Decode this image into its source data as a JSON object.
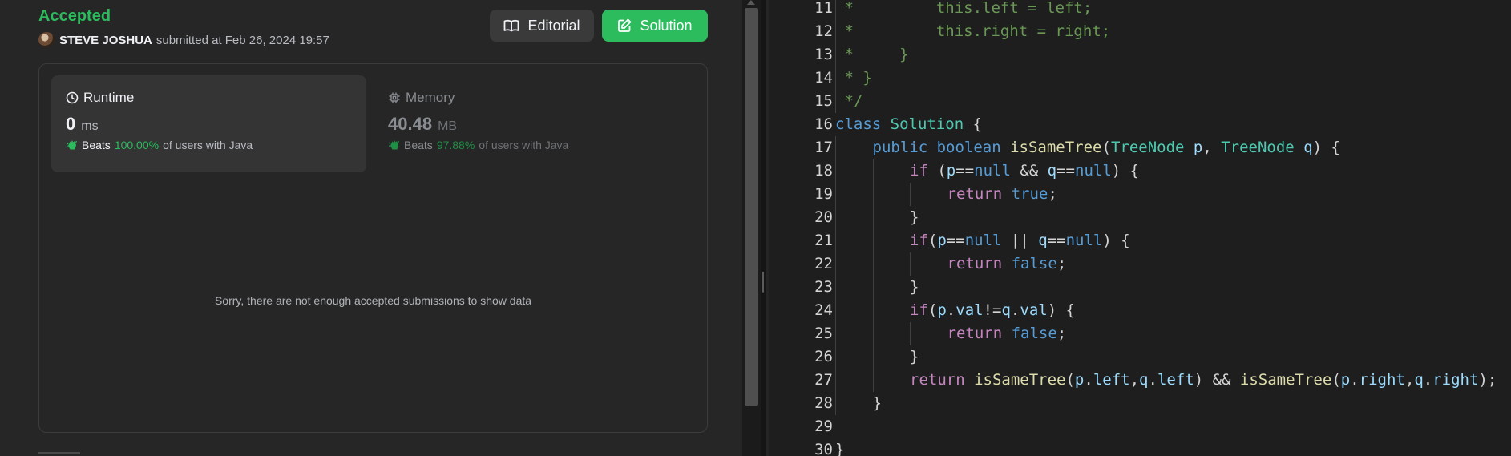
{
  "submission": {
    "status": "Accepted",
    "username": "STEVE JOSHUA",
    "submitted_text": "submitted at Feb 26, 2024 19:57"
  },
  "buttons": {
    "editorial": "Editorial",
    "solution": "Solution"
  },
  "runtime": {
    "label": "Runtime",
    "value": "0",
    "unit": "ms",
    "beats_label": "Beats",
    "beats_pct": "100.00%",
    "beats_tail": "of users with Java"
  },
  "memory": {
    "label": "Memory",
    "value": "40.48",
    "unit": "MB",
    "beats_label": "Beats",
    "beats_pct": "97.88%",
    "beats_tail": "of users with Java"
  },
  "chart_message": "Sorry, there are not enough accepted submissions to show data",
  "colors": {
    "accent_green": "#2cbb5d",
    "panel_bg": "#262626",
    "editor_bg": "#1e1e1e"
  },
  "code": {
    "language": "Java",
    "lines": [
      {
        "n": "11",
        "indent": 0,
        "tokens": [
          {
            "c": "comment",
            "t": " *         this.left = left;"
          }
        ]
      },
      {
        "n": "12",
        "indent": 0,
        "tokens": [
          {
            "c": "comment",
            "t": " *         this.right = right;"
          }
        ]
      },
      {
        "n": "13",
        "indent": 0,
        "tokens": [
          {
            "c": "comment",
            "t": " *     }"
          }
        ]
      },
      {
        "n": "14",
        "indent": 0,
        "tokens": [
          {
            "c": "comment",
            "t": " * }"
          }
        ]
      },
      {
        "n": "15",
        "indent": 0,
        "tokens": [
          {
            "c": "comment",
            "t": " */"
          }
        ]
      },
      {
        "n": "16",
        "indent": 0,
        "tokens": [
          {
            "c": "kw",
            "t": "class "
          },
          {
            "c": "type",
            "t": "Solution"
          },
          {
            "c": "plain",
            "t": " {"
          }
        ]
      },
      {
        "n": "17",
        "indent": 1,
        "tokens": [
          {
            "c": "kw",
            "t": "public "
          },
          {
            "c": "kw",
            "t": "boolean "
          },
          {
            "c": "fn",
            "t": "isSameTree"
          },
          {
            "c": "plain",
            "t": "("
          },
          {
            "c": "type",
            "t": "TreeNode"
          },
          {
            "c": "var",
            "t": " p"
          },
          {
            "c": "plain",
            "t": ", "
          },
          {
            "c": "type",
            "t": "TreeNode"
          },
          {
            "c": "var",
            "t": " q"
          },
          {
            "c": "plain",
            "t": ") {"
          }
        ]
      },
      {
        "n": "18",
        "indent": 2,
        "tokens": [
          {
            "c": "ctrl",
            "t": "if"
          },
          {
            "c": "plain",
            "t": " ("
          },
          {
            "c": "var",
            "t": "p"
          },
          {
            "c": "plain",
            "t": "=="
          },
          {
            "c": "kw",
            "t": "null"
          },
          {
            "c": "plain",
            "t": " && "
          },
          {
            "c": "var",
            "t": "q"
          },
          {
            "c": "plain",
            "t": "=="
          },
          {
            "c": "kw",
            "t": "null"
          },
          {
            "c": "plain",
            "t": ") {"
          }
        ]
      },
      {
        "n": "19",
        "indent": 3,
        "tokens": [
          {
            "c": "ctrl",
            "t": "return "
          },
          {
            "c": "kw",
            "t": "true"
          },
          {
            "c": "plain",
            "t": ";"
          }
        ]
      },
      {
        "n": "20",
        "indent": 2,
        "tokens": [
          {
            "c": "plain",
            "t": "}"
          }
        ]
      },
      {
        "n": "21",
        "indent": 2,
        "tokens": [
          {
            "c": "ctrl",
            "t": "if"
          },
          {
            "c": "plain",
            "t": "("
          },
          {
            "c": "var",
            "t": "p"
          },
          {
            "c": "plain",
            "t": "=="
          },
          {
            "c": "kw",
            "t": "null"
          },
          {
            "c": "plain",
            "t": " || "
          },
          {
            "c": "var",
            "t": "q"
          },
          {
            "c": "plain",
            "t": "=="
          },
          {
            "c": "kw",
            "t": "null"
          },
          {
            "c": "plain",
            "t": ") {"
          }
        ]
      },
      {
        "n": "22",
        "indent": 3,
        "tokens": [
          {
            "c": "ctrl",
            "t": "return "
          },
          {
            "c": "kw",
            "t": "false"
          },
          {
            "c": "plain",
            "t": ";"
          }
        ]
      },
      {
        "n": "23",
        "indent": 2,
        "tokens": [
          {
            "c": "plain",
            "t": "}"
          }
        ]
      },
      {
        "n": "24",
        "indent": 2,
        "tokens": [
          {
            "c": "ctrl",
            "t": "if"
          },
          {
            "c": "plain",
            "t": "("
          },
          {
            "c": "var",
            "t": "p"
          },
          {
            "c": "plain",
            "t": "."
          },
          {
            "c": "var",
            "t": "val"
          },
          {
            "c": "plain",
            "t": "!="
          },
          {
            "c": "var",
            "t": "q"
          },
          {
            "c": "plain",
            "t": "."
          },
          {
            "c": "var",
            "t": "val"
          },
          {
            "c": "plain",
            "t": ") {"
          }
        ]
      },
      {
        "n": "25",
        "indent": 3,
        "tokens": [
          {
            "c": "ctrl",
            "t": "return "
          },
          {
            "c": "kw",
            "t": "false"
          },
          {
            "c": "plain",
            "t": ";"
          }
        ]
      },
      {
        "n": "26",
        "indent": 2,
        "tokens": [
          {
            "c": "plain",
            "t": "}"
          }
        ]
      },
      {
        "n": "27",
        "indent": 2,
        "tokens": [
          {
            "c": "ctrl",
            "t": "return "
          },
          {
            "c": "fn",
            "t": "isSameTree"
          },
          {
            "c": "plain",
            "t": "("
          },
          {
            "c": "var",
            "t": "p"
          },
          {
            "c": "plain",
            "t": "."
          },
          {
            "c": "var",
            "t": "left"
          },
          {
            "c": "plain",
            "t": ","
          },
          {
            "c": "var",
            "t": "q"
          },
          {
            "c": "plain",
            "t": "."
          },
          {
            "c": "var",
            "t": "left"
          },
          {
            "c": "plain",
            "t": ") && "
          },
          {
            "c": "fn",
            "t": "isSameTree"
          },
          {
            "c": "plain",
            "t": "("
          },
          {
            "c": "var",
            "t": "p"
          },
          {
            "c": "plain",
            "t": "."
          },
          {
            "c": "var",
            "t": "right"
          },
          {
            "c": "plain",
            "t": ","
          },
          {
            "c": "var",
            "t": "q"
          },
          {
            "c": "plain",
            "t": "."
          },
          {
            "c": "var",
            "t": "right"
          },
          {
            "c": "plain",
            "t": ");"
          }
        ]
      },
      {
        "n": "28",
        "indent": 1,
        "tokens": [
          {
            "c": "plain",
            "t": "}"
          }
        ]
      },
      {
        "n": "29",
        "indent": 0,
        "tokens": []
      },
      {
        "n": "30",
        "indent": 0,
        "tokens": [
          {
            "c": "plain",
            "t": "}"
          }
        ]
      }
    ]
  }
}
